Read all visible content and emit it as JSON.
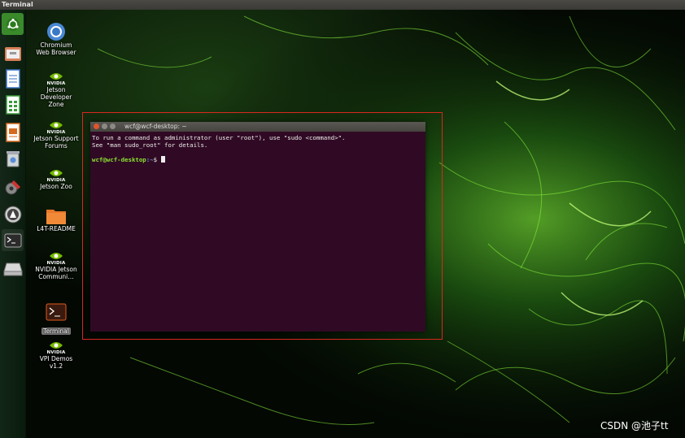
{
  "topbar": {
    "title": "Terminal"
  },
  "launcher": {
    "items": [
      {
        "name": "ubuntu-dash-icon"
      },
      {
        "name": "files-icon"
      },
      {
        "name": "writer-icon"
      },
      {
        "name": "calc-icon"
      },
      {
        "name": "impress-icon"
      },
      {
        "name": "trash-icon"
      },
      {
        "name": "settings-icon"
      },
      {
        "name": "software-updater-icon"
      },
      {
        "name": "terminal-icon"
      },
      {
        "name": "drive-icon"
      }
    ]
  },
  "desktop": {
    "icons": [
      {
        "nvidia": "",
        "label": "Chromium Web Browser"
      },
      {
        "nvidia": "NVIDIA",
        "label": "Jetson Developer Zone"
      },
      {
        "nvidia": "NVIDIA",
        "label": "Jetson Support Forums"
      },
      {
        "nvidia": "NVIDIA",
        "label": "Jetson Zoo"
      },
      {
        "nvidia": "",
        "label": "L4T-README"
      },
      {
        "nvidia": "NVIDIA",
        "label": "NVIDIA Jetson Communi…"
      },
      {
        "nvidia": "",
        "label": "Terminal"
      },
      {
        "nvidia": "NVIDIA",
        "label": "VPI Demos v1.2"
      }
    ]
  },
  "terminal": {
    "title": "wcf@wcf-desktop: ~",
    "line1": "To run a command as administrator (user \"root\"), use \"sudo <command>\".",
    "line2": "See \"man sudo_root\" for details.",
    "prompt_user": "wcf@wcf-desktop",
    "prompt_path": ":~",
    "prompt_symbol": "$ "
  },
  "watermark": "CSDN @池子tt",
  "colors": {
    "terminal_bg": "#300a24",
    "highlight": "#d8281f",
    "prompt_green": "#8ae234"
  }
}
